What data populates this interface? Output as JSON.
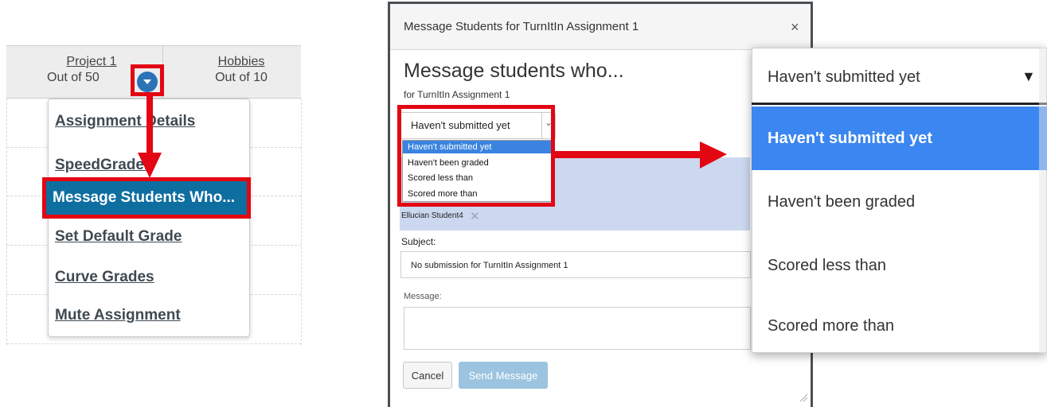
{
  "gradebook": {
    "columns": [
      {
        "name": "Project 1",
        "points": "Out of 50"
      },
      {
        "name": "Hobbies",
        "points": "Out of 10"
      }
    ],
    "menu_items": [
      "Assignment Details",
      "SpeedGrader",
      "Message Students Who...",
      "Set Default Grade",
      "Curve Grades",
      "Mute Assignment"
    ]
  },
  "modal": {
    "title": "Message Students for TurnItIn Assignment 1",
    "close": "×",
    "heading": "Message students who...",
    "subheading": "for TurnItIn Assignment 1",
    "criteria_selected": "Haven't submitted yet",
    "criteria_options": [
      "Haven't submitted yet",
      "Haven't been graded",
      "Scored less than",
      "Scored more than"
    ],
    "recipient": "Ellucian Student4",
    "subject_label": "Subject:",
    "subject_value": "No submission for TurnItIn Assignment 1",
    "message_label": "Message:",
    "message_value": "",
    "cancel_label": "Cancel",
    "send_label": "Send Message"
  },
  "zoom": {
    "selected": "Haven't submitted yet",
    "caret": "▼",
    "options": [
      "Haven't submitted yet",
      "Haven't been graded",
      "Scored less than",
      "Scored more than"
    ]
  },
  "colors": {
    "annotation_red": "#e30613",
    "menu_active": "#0e6ea0",
    "option_highlight": "#3b86f0",
    "send_disabled": "#9cc4e0"
  }
}
